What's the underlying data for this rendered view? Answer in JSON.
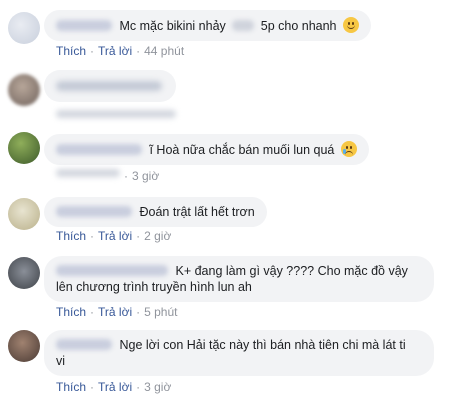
{
  "comments": [
    {
      "text_before": "Mc mặc bikini nhảy",
      "text_after": "5p cho nhanh",
      "emoji": "smile-emoji",
      "actions": {
        "like": "Thích",
        "reply": "Trả lời",
        "time": "44 phút"
      }
    },
    {
      "text": "",
      "actions": {
        "like": "",
        "reply": "",
        "time": ""
      }
    },
    {
      "text": "ĩ Hoà nữa chắc bán muối lun quá",
      "emoji": "crying-emoji",
      "actions": {
        "like": "",
        "reply": "",
        "time": "3 giờ"
      }
    },
    {
      "text": "Đoán trật lất hết trơn",
      "actions": {
        "like": "Thích",
        "reply": "Trả lời",
        "time": "2 giờ"
      }
    },
    {
      "line1": "K+ đang làm gì vậy ???? Cho mặc đồ vậy",
      "line2": "lên chương trình truyền hình lun ah",
      "actions": {
        "like": "Thích",
        "reply": "Trả lời",
        "time": "5 phút"
      }
    },
    {
      "line1": "Nge lời con Hải tặc này thì bán nhà tiên chi mà lát ti",
      "line2": "vi",
      "actions": {
        "like": "Thích",
        "reply": "Trả lời",
        "time": "3 giờ"
      }
    }
  ],
  "colors": {
    "bubble": "#f2f3f5",
    "action_link": "#385898",
    "time": "#90949c",
    "text": "#1c1e21"
  }
}
